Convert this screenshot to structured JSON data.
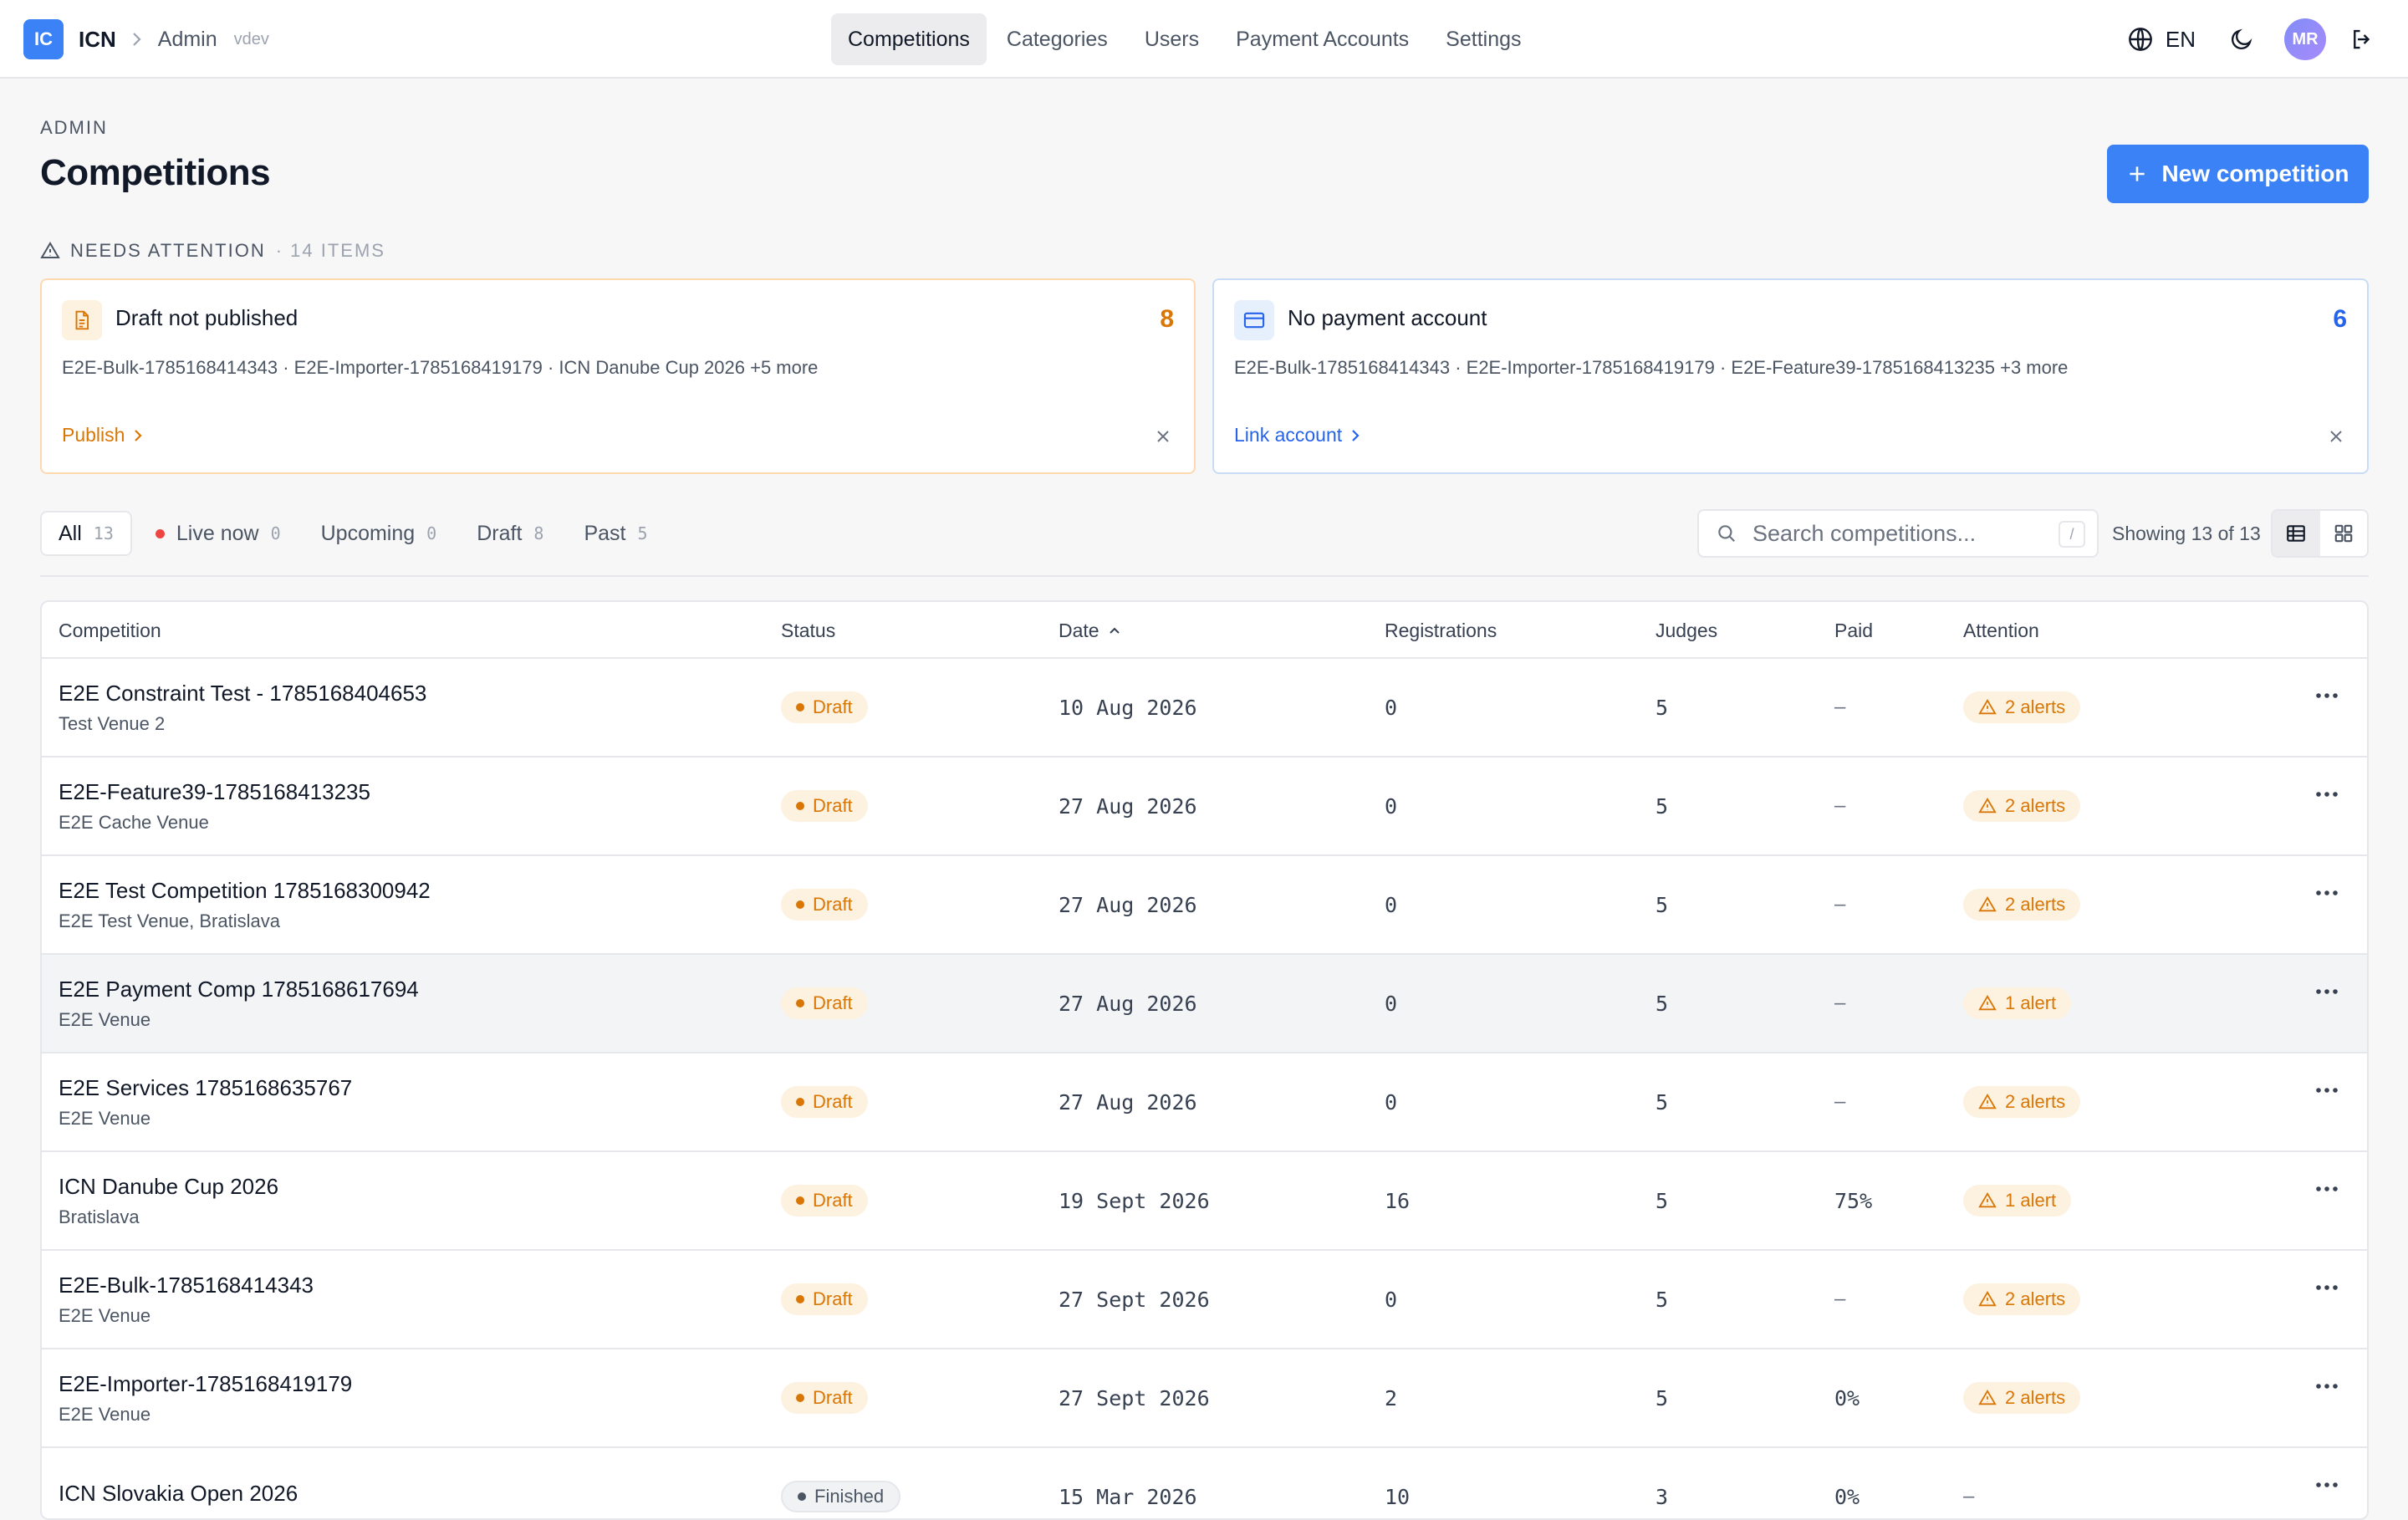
{
  "header": {
    "logo": "IC",
    "brand": "ICN",
    "breadcrumb_sep": "›",
    "breadcrumb": "Admin",
    "version": "vdev",
    "nav": [
      "Competitions",
      "Categories",
      "Users",
      "Payment Accounts",
      "Settings"
    ],
    "lang": "EN",
    "avatar": "MR",
    "icons": [
      "globe-icon",
      "moon-icon",
      "logout-icon"
    ]
  },
  "page": {
    "eyebrow": "ADMIN",
    "title": "Competitions",
    "new_button": "New competition"
  },
  "attention": {
    "label": "NEEDS ATTENTION",
    "count": "· 14 ITEMS",
    "cards": [
      {
        "title": "Draft not published",
        "number": "8",
        "desc": "E2E-Bulk-1785168414343 · E2E-Importer-1785168419179 · ICN Danube Cup 2026 +5 more",
        "link": "Publish",
        "accent": "#d97706",
        "icon": "document-icon"
      },
      {
        "title": "No payment account",
        "number": "6",
        "desc": "E2E-Bulk-1785168414343 · E2E-Importer-1785168419179 · E2E-Feature39-1785168413235 +3 more",
        "link": "Link account",
        "accent": "#2563eb",
        "icon": "credit-card-icon"
      }
    ]
  },
  "filters": {
    "tabs": [
      {
        "label": "All",
        "count": "13"
      },
      {
        "label": "Live now",
        "count": "0"
      },
      {
        "label": "Upcoming",
        "count": "0"
      },
      {
        "label": "Draft",
        "count": "8"
      },
      {
        "label": "Past",
        "count": "5"
      }
    ],
    "search_placeholder": "Search competitions...",
    "search_shortcut": "/",
    "showing": "Showing 13 of 13"
  },
  "table": {
    "columns": [
      "Competition",
      "Status",
      "Date",
      "Registrations",
      "Judges",
      "Paid",
      "Attention"
    ],
    "rows": [
      {
        "name": "E2E Constraint Test - 1785168404653",
        "venue": "Test Venue 2",
        "status": "Draft",
        "date": "10 Aug 2026",
        "registrations": "0",
        "judges": "5",
        "paid": "–",
        "attention": "2 alerts"
      },
      {
        "name": "E2E-Feature39-1785168413235",
        "venue": "E2E Cache Venue",
        "status": "Draft",
        "date": "27 Aug 2026",
        "registrations": "0",
        "judges": "5",
        "paid": "–",
        "attention": "2 alerts"
      },
      {
        "name": "E2E Test Competition 1785168300942",
        "venue": "E2E Test Venue, Bratislava",
        "status": "Draft",
        "date": "27 Aug 2026",
        "registrations": "0",
        "judges": "5",
        "paid": "–",
        "attention": "2 alerts"
      },
      {
        "name": "E2E Payment Comp 1785168617694",
        "venue": "E2E Venue",
        "status": "Draft",
        "date": "27 Aug 2026",
        "registrations": "0",
        "judges": "5",
        "paid": "–",
        "attention": "1 alert"
      },
      {
        "name": "E2E Services 1785168635767",
        "venue": "E2E Venue",
        "status": "Draft",
        "date": "27 Aug 2026",
        "registrations": "0",
        "judges": "5",
        "paid": "–",
        "attention": "2 alerts"
      },
      {
        "name": "ICN Danube Cup 2026",
        "venue": "Bratislava",
        "status": "Draft",
        "date": "19 Sept 2026",
        "registrations": "16",
        "judges": "5",
        "paid": "75%",
        "attention": "1 alert"
      },
      {
        "name": "E2E-Bulk-1785168414343",
        "venue": "E2E Venue",
        "status": "Draft",
        "date": "27 Sept 2026",
        "registrations": "0",
        "judges": "5",
        "paid": "–",
        "attention": "2 alerts"
      },
      {
        "name": "E2E-Importer-1785168419179",
        "venue": "E2E Venue",
        "status": "Draft",
        "date": "27 Sept 2026",
        "registrations": "2",
        "judges": "5",
        "paid": "0%",
        "attention": "2 alerts"
      },
      {
        "name": "ICN Slovakia Open 2026",
        "venue": "",
        "status": "Finished",
        "date": "15 Mar 2026",
        "registrations": "10",
        "judges": "3",
        "paid": "0%",
        "attention": "–"
      }
    ]
  }
}
